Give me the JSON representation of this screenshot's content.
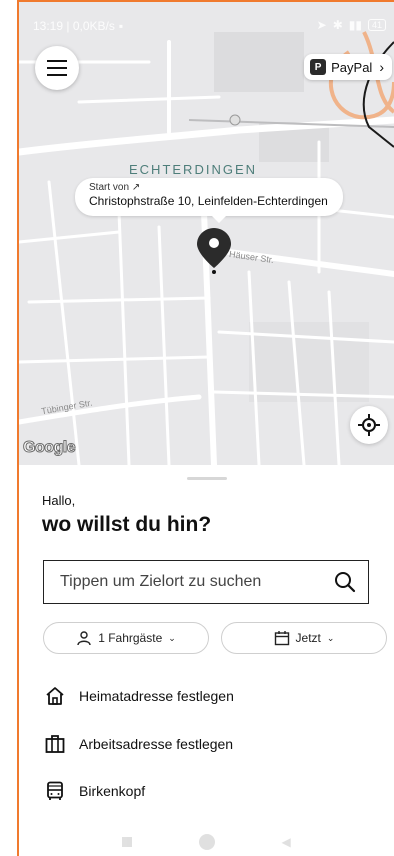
{
  "statusbar": {
    "time_net": "13:19 | 0,0KB/s",
    "battery": "41"
  },
  "paypal": {
    "label": "PayPal",
    "logo": "P"
  },
  "map": {
    "city_label": "ECHTERDINGEN",
    "start_prefix": "Start von",
    "start_address": "Christophstraße 10, Leinfelden-Echterdingen",
    "street_1": "Häuser Str.",
    "street_2": "Tübinger Str.",
    "attribution": "Google"
  },
  "sheet": {
    "greeting": "Hallo,",
    "question": "wo willst du hin?",
    "search_placeholder": "Tippen um Zielort zu suchen",
    "passengers_label": "1 Fahrgäste",
    "time_label": "Jetzt",
    "items": [
      {
        "icon": "home-icon",
        "label": "Heimatadresse festlegen"
      },
      {
        "icon": "briefcase-icon",
        "label": "Arbeitsadresse festlegen"
      },
      {
        "icon": "bus-icon",
        "label": "Birkenkopf"
      }
    ]
  },
  "colors": {
    "frame": "#f07a2e",
    "map_bg": "#e9e9eb",
    "city": "#4e7e7a"
  }
}
